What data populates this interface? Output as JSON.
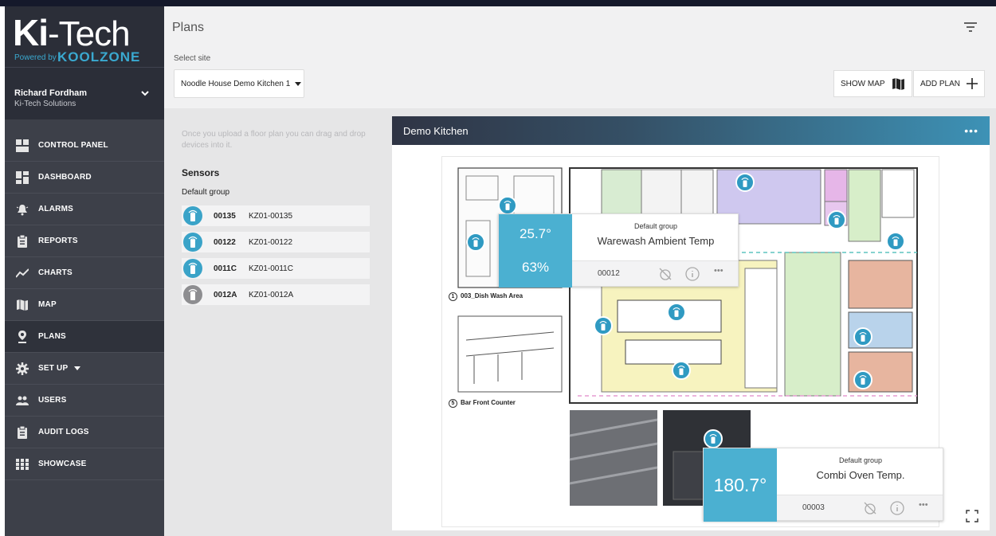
{
  "brand": {
    "logo_bold": "Ki",
    "logo_light": "-Tech",
    "powered_by": "Powered by",
    "koolzone": "KOOLZONE"
  },
  "user": {
    "name": "Richard Fordham",
    "company": "Ki-Tech Solutions"
  },
  "nav": [
    {
      "label": "CONTROL PANEL",
      "icon": "control-panel-icon"
    },
    {
      "label": "DASHBOARD",
      "icon": "dashboard-icon"
    },
    {
      "label": "ALARMS",
      "icon": "bell-icon"
    },
    {
      "label": "REPORTS",
      "icon": "clipboard-icon"
    },
    {
      "label": "CHARTS",
      "icon": "line-chart-icon"
    },
    {
      "label": "MAP",
      "icon": "map-icon"
    },
    {
      "label": "PLANS",
      "icon": "location-pin-icon"
    },
    {
      "label": "SET UP",
      "icon": "gear-icon"
    },
    {
      "label": "USERS",
      "icon": "users-icon"
    },
    {
      "label": "AUDIT LOGS",
      "icon": "clipboard-icon"
    },
    {
      "label": "SHOWCASE",
      "icon": "grid-icon"
    }
  ],
  "header": {
    "title": "Plans",
    "site_label": "Select site",
    "site_value": "Noodle House Demo Kitchen 1",
    "show_map": "SHOW MAP",
    "add_plan": "ADD PLAN"
  },
  "left": {
    "hint": "Once you upload a floor plan you can drag and drop devices into it.",
    "sensors_title": "Sensors",
    "group": "Default group",
    "sensors": [
      {
        "id": "00135",
        "name": "KZ01-00135",
        "status": "online"
      },
      {
        "id": "00122",
        "name": "KZ01-00122",
        "status": "online"
      },
      {
        "id": "0011C",
        "name": "KZ01-0011C",
        "status": "online"
      },
      {
        "id": "0012A",
        "name": "KZ01-0012A",
        "status": "offline"
      }
    ]
  },
  "plan": {
    "title": "Demo Kitchen",
    "area_1_num": "1",
    "area_1_label": "003_Dish Wash Area",
    "area_5_num": "5",
    "area_5_label": "Bar Front Counter",
    "popup1": {
      "temp": "25.7°",
      "humidity": "63%",
      "group": "Default group",
      "name": "Warewash Ambient Temp",
      "id": "00012"
    },
    "popup2": {
      "temp": "180.7°",
      "group": "Default group",
      "name": "Combi Oven Temp.",
      "id": "00003"
    }
  },
  "colors": {
    "accent": "#3aa3c8",
    "sidebar": "#3d4049",
    "header_gradient_end": "#3d92b6"
  }
}
